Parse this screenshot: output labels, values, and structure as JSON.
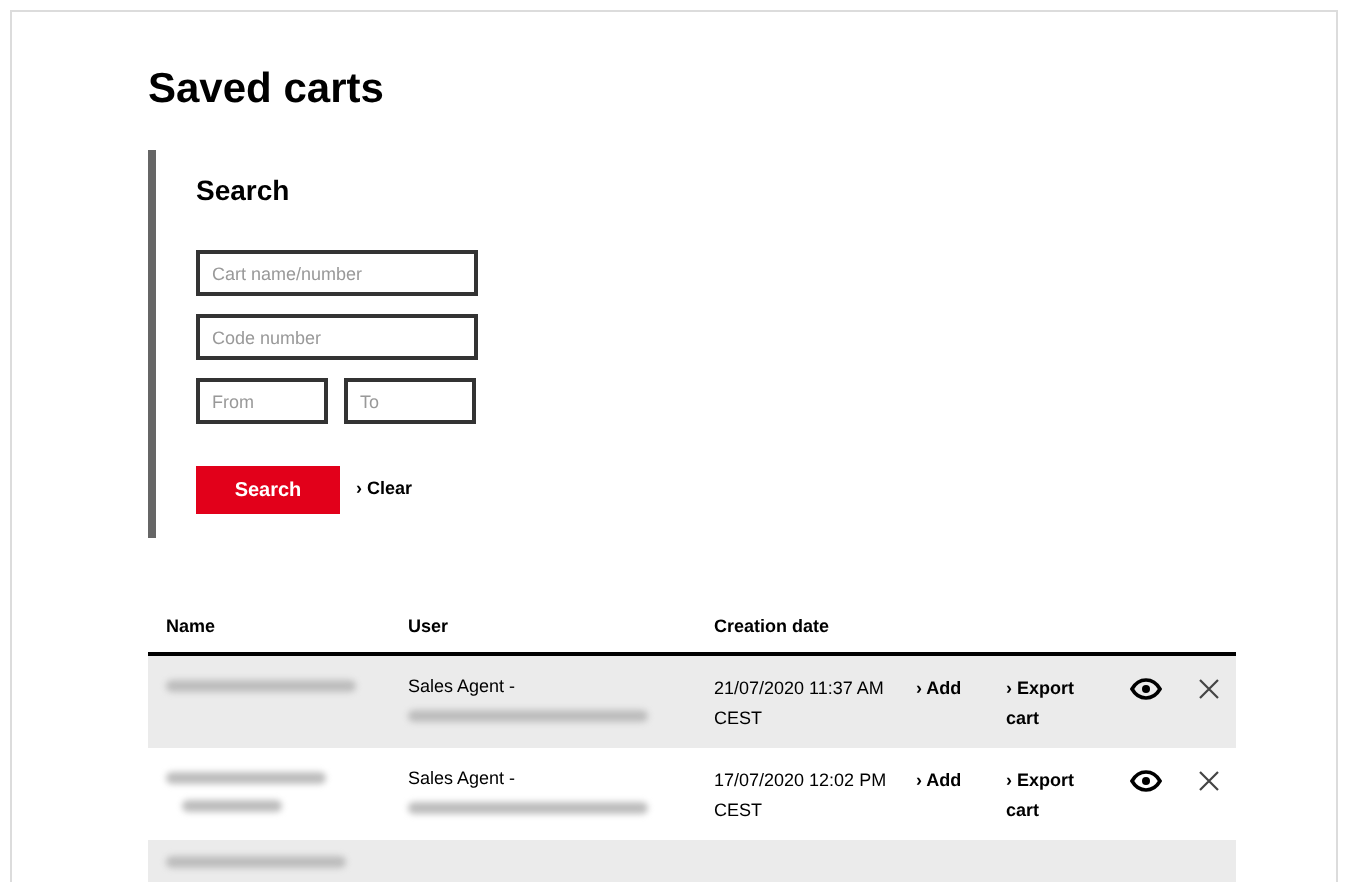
{
  "title": "Saved carts",
  "search": {
    "heading": "Search",
    "fields": [
      {
        "placeholder": "Cart name/number"
      },
      {
        "placeholder": "Code number"
      }
    ],
    "date_fields": [
      {
        "placeholder": "From"
      },
      {
        "placeholder": "To"
      }
    ],
    "submit": "Search",
    "clear": "Clear",
    "clear_icon": "›"
  },
  "table": {
    "columns": [
      "Name",
      "User",
      "Creation date"
    ],
    "rows": [
      {
        "user": "Sales Agent -",
        "date": "21/07/2020 11:37 AM CEST",
        "add": "Add",
        "export": "Export cart"
      },
      {
        "user": "Sales Agent -",
        "date": "17/07/2020 12:02 PM CEST",
        "add": "Add",
        "export": "Export cart"
      }
    ],
    "link_icon": "›"
  }
}
